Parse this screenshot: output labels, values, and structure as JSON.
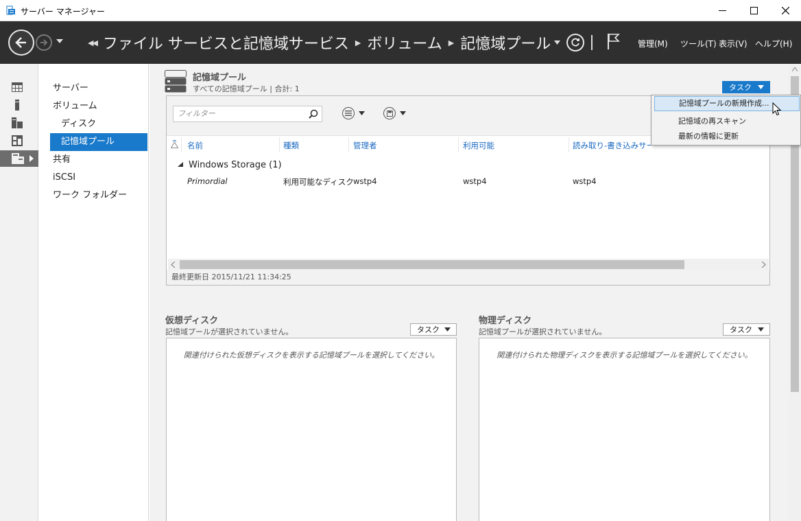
{
  "window": {
    "title": "サーバー マネージャー"
  },
  "header": {
    "breadcrumb": [
      "ファイル サービスと記憶域サービス",
      "ボリューム",
      "記憶域プール"
    ],
    "menus": [
      "管理(M)",
      "ツール(T)",
      "表示(V)",
      "ヘルプ(H)"
    ]
  },
  "rail": {
    "items": [
      "dashboard-icon",
      "local-server-icon",
      "all-servers-icon",
      "roles-icon",
      "file-services-icon"
    ]
  },
  "nav": {
    "items": [
      {
        "label": "サーバー",
        "level": 0
      },
      {
        "label": "ボリューム",
        "level": 0
      },
      {
        "label": "ディスク",
        "level": 1
      },
      {
        "label": "記憶域プール",
        "level": 1,
        "selected": true
      },
      {
        "label": "共有",
        "level": 0
      },
      {
        "label": "iSCSI",
        "level": 0
      },
      {
        "label": "ワーク フォルダー",
        "level": 0
      }
    ]
  },
  "pools": {
    "title": "記憶域プール",
    "subtitle": "すべての記憶域プール | 合計: 1",
    "task_label": "タスク",
    "filter_placeholder": "フィルター",
    "columns": [
      "名前",
      "種類",
      "管理者",
      "利用可能",
      "読み取り-書き込みサーバ"
    ],
    "group": "Windows Storage (1)",
    "rows": [
      {
        "name": "Primordial",
        "type": "利用可能なディスク",
        "manager": "wstp4",
        "available": "wstp4",
        "rw_server": "wstp4"
      }
    ],
    "status": "最終更新日 2015/11/21 11:34:25"
  },
  "context_menu": {
    "items": [
      "記憶域プールの新規作成...",
      "記憶域の再スキャン",
      "最新の情報に更新"
    ]
  },
  "virtual_disks": {
    "title": "仮想ディスク",
    "subtitle": "記憶域プールが選択されていません。",
    "task_label": "タスク",
    "empty": "関連付けられた仮想ディスクを表示する記憶域プールを選択してください。"
  },
  "physical_disks": {
    "title": "物理ディスク",
    "subtitle": "記憶域プールが選択されていません。",
    "task_label": "タスク",
    "empty": "関連付けられた物理ディスクを表示する記憶域プールを選択してください。"
  },
  "colors": {
    "header_bg": "#2f2f2f",
    "accent": "#1979ca",
    "column_text": "#1b6ac1"
  }
}
